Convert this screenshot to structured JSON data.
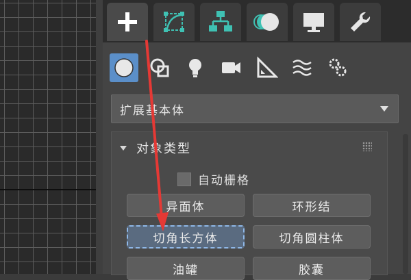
{
  "tabs": [
    {
      "icon": "create-plus-icon",
      "active": true
    },
    {
      "icon": "modify-curve-icon",
      "active": false
    },
    {
      "icon": "hierarchy-icon",
      "active": false
    },
    {
      "icon": "motion-icon",
      "active": false
    },
    {
      "icon": "display-monitor-icon",
      "active": false
    },
    {
      "icon": "utilities-wrench-icon",
      "active": false
    }
  ],
  "sub_icons": [
    {
      "icon": "geometry-sphere-icon",
      "active": true
    },
    {
      "icon": "shapes-icon",
      "active": false
    },
    {
      "icon": "lights-bulb-icon",
      "active": false
    },
    {
      "icon": "cameras-icon",
      "active": false
    },
    {
      "icon": "helpers-ruler-icon",
      "active": false
    },
    {
      "icon": "space-warps-icon",
      "active": false
    },
    {
      "icon": "systems-gears-icon",
      "active": false
    }
  ],
  "category_dropdown": {
    "value": "扩展基本体"
  },
  "object_type": {
    "title": "对象类型",
    "auto_grid_label": "自动栅格",
    "auto_grid_checked": false,
    "buttons": [
      {
        "label": "异面体",
        "selected": false
      },
      {
        "label": "环形结",
        "selected": false
      },
      {
        "label": "切角长方体",
        "selected": true
      },
      {
        "label": "切角圆柱体",
        "selected": false
      },
      {
        "label": "油罐",
        "selected": false
      },
      {
        "label": "胶囊",
        "selected": false
      }
    ]
  },
  "colors": {
    "accent_blue": "#5b8fc9",
    "annotation_red": "#e53935"
  }
}
